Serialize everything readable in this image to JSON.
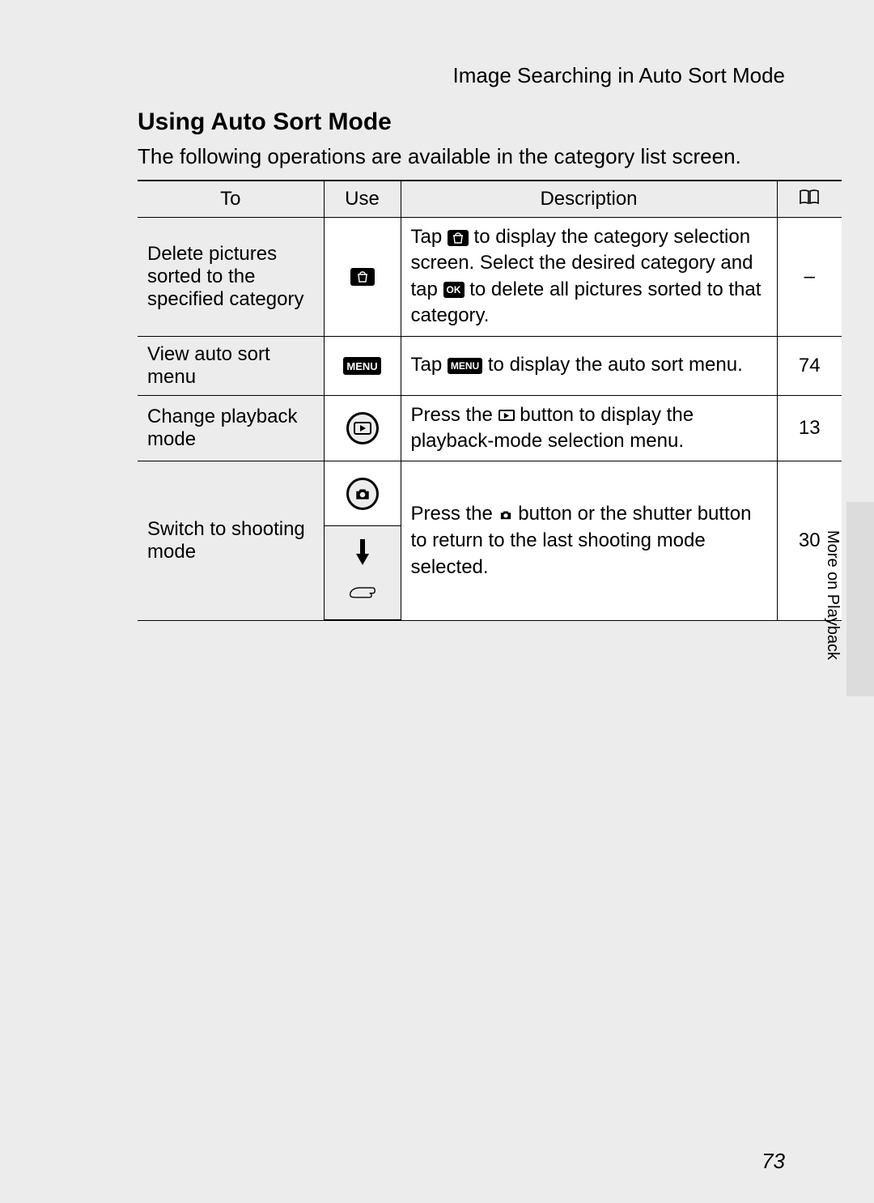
{
  "running_head": "Image Searching in Auto Sort Mode",
  "section_heading": "Using Auto Sort Mode",
  "intro_text": "The following operations are available in the category list screen.",
  "side_tab_text": "More on Playback",
  "page_number": "73",
  "table": {
    "headers": {
      "to": "To",
      "use": "Use",
      "description": "Description",
      "page_icon": "book-icon"
    },
    "rows": [
      {
        "to": "Delete pictures sorted to the specified category",
        "use_icon": "trash",
        "desc_pre": "Tap ",
        "desc_icon1": "trash",
        "desc_mid1": " to display the category selection screen. Select the desired category and tap ",
        "desc_icon2": "ok",
        "desc_mid2": " to delete all pictures sorted to that category.",
        "page": "–"
      },
      {
        "to": "View auto sort menu",
        "use_icon": "menu",
        "desc_pre": "Tap ",
        "desc_icon1": "menu",
        "desc_mid1": " to display the auto sort menu.",
        "page": "74"
      },
      {
        "to": "Change playback mode",
        "use_icon": "playback-ring",
        "desc_pre": "Press the ",
        "desc_icon1": "play-box",
        "desc_mid1": " button to display the playback-mode selection menu.",
        "page": "13"
      },
      {
        "to": "Switch to shooting mode",
        "use_icon": "camera-ring-and-shutter",
        "desc_pre": "Press the ",
        "desc_icon1": "camera-solid",
        "desc_mid1": " button or the shutter button to return to the last shooting mode selected.",
        "page": "30"
      }
    ]
  }
}
